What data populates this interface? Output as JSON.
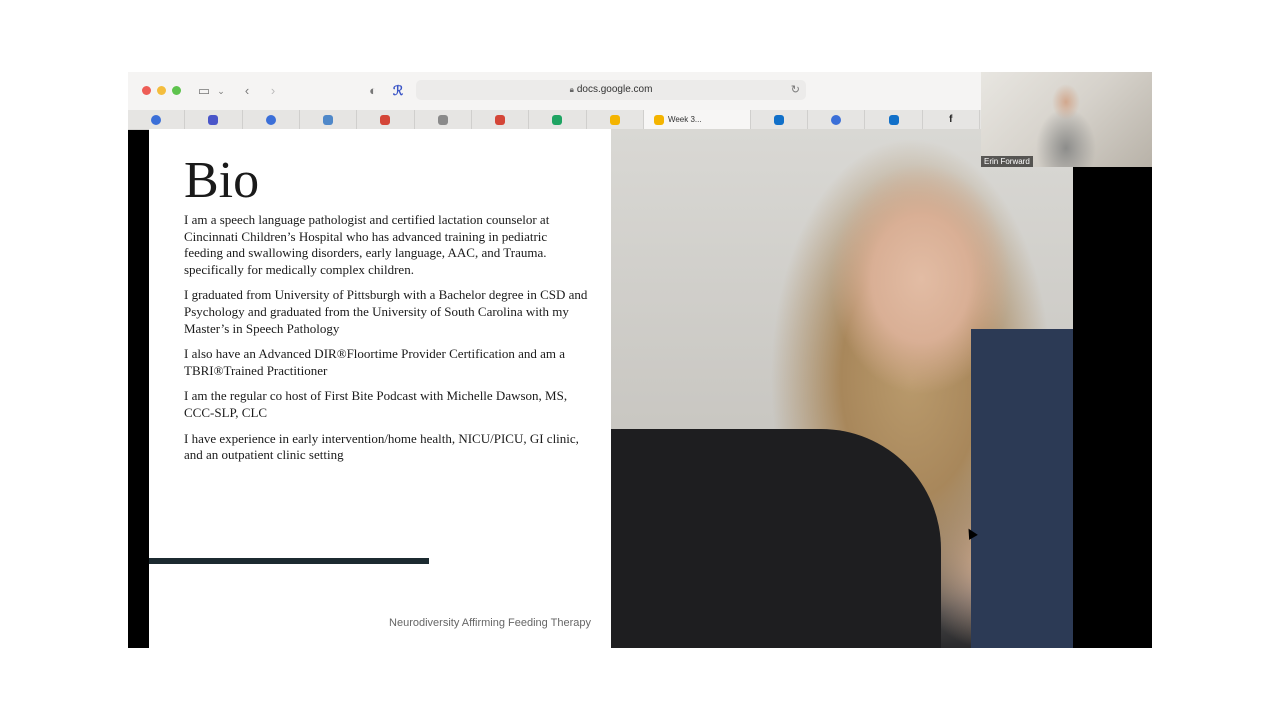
{
  "browser": {
    "url": "docs.google.com",
    "tabs": [
      {
        "label": "",
        "icon": "google-circle-icon",
        "color": "#3b6fd8"
      },
      {
        "label": "",
        "icon": "chat-icon",
        "color": "#4a56c9"
      },
      {
        "label": "",
        "icon": "google-circle-icon",
        "color": "#3b6fd8"
      },
      {
        "label": "",
        "icon": "photo-icon",
        "color": "#4f88c9"
      },
      {
        "label": "",
        "icon": "gmail-icon",
        "color": "#d44638"
      },
      {
        "label": "",
        "icon": "grey-square-icon",
        "color": "#8a8a8a"
      },
      {
        "label": "",
        "icon": "gmail-icon",
        "color": "#d44638"
      },
      {
        "label": "",
        "icon": "drive-icon",
        "color": "#1fa463"
      },
      {
        "label": "",
        "icon": "slides-icon",
        "color": "#f4b400"
      },
      {
        "label": "Week 3...",
        "icon": "slides-icon",
        "color": "#f4b400",
        "active": true
      },
      {
        "label": "",
        "icon": "outlook-icon",
        "color": "#1170c9"
      },
      {
        "label": "",
        "icon": "gear-circle-icon",
        "color": "#3b6fd8"
      },
      {
        "label": "",
        "icon": "outlook-icon",
        "color": "#1170c9"
      },
      {
        "label": "f",
        "icon": "facebook-icon",
        "color": "#222222"
      },
      {
        "label": "",
        "icon": "blue-circle-icon",
        "color": "#3a6ff0"
      },
      {
        "label": "",
        "icon": "k-icon",
        "color": "#2f6fe0"
      },
      {
        "label": "",
        "icon": "k-icon",
        "color": "#2f6fe0"
      }
    ]
  },
  "slide": {
    "title": "Bio",
    "paragraphs": [
      "I am a speech language pathologist and certified lactation counselor at Cincinnati Children’s Hospital who has advanced training in pediatric feeding and swallowing disorders, early language, AAC, and Trauma. specifically for medically complex children.",
      "I graduated from University of Pittsburgh with a Bachelor degree in CSD and Psychology and graduated from the University of South Carolina with my Master’s in Speech Pathology",
      "I also have an Advanced  DIR®Floortime Provider Certification and am a TBRI®Trained Practitioner",
      "I am the regular co host of First Bite Podcast with Michelle Dawson, MS, CCC-SLP,  CLC",
      "I have experience in early intervention/home health, NICU/PICU, GI clinic, and an outpatient clinic setting"
    ],
    "footer": "Neurodiversity Affirming Feeding Therapy"
  },
  "webcam": {
    "name": "Erin Forward"
  }
}
